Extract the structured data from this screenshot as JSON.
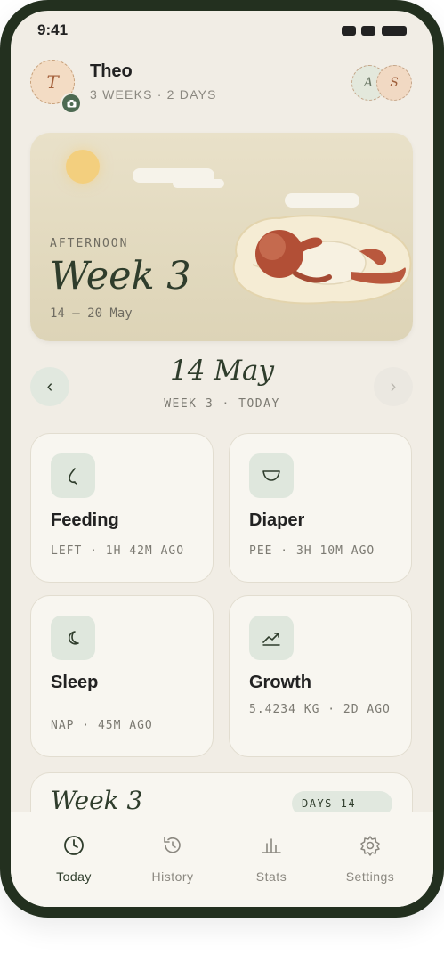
{
  "status": {
    "time": "9:41"
  },
  "profile": {
    "initial": "T",
    "name": "Theo",
    "age": "3 WEEKS · 2 DAYS",
    "caregivers": [
      "A",
      "S"
    ]
  },
  "hero": {
    "part_of_day": "AFTERNOON",
    "title": "Week 3",
    "range": "14 — 20 May"
  },
  "date_nav": {
    "date": "14 May",
    "subtitle": "WEEK 3 · TODAY"
  },
  "cards": [
    {
      "title": "Feeding",
      "subtitle": "LEFT · 1H 42M AGO",
      "icon": "feeding-icon"
    },
    {
      "title": "Diaper",
      "subtitle": "PEE · 3H 10M AGO",
      "icon": "diaper-icon"
    },
    {
      "title": "Sleep",
      "subtitle": "NAP · 45M AGO",
      "icon": "moon-icon"
    },
    {
      "title": "Growth",
      "subtitle": "5.4234 KG · 2D AGO",
      "icon": "trend-icon"
    }
  ],
  "week_summary": {
    "title": "Week 3",
    "badge": "DAYS 14–"
  },
  "tabs": [
    {
      "label": "Today",
      "icon": "clock-icon",
      "active": true
    },
    {
      "label": "History",
      "icon": "history-icon",
      "active": false
    },
    {
      "label": "Stats",
      "icon": "bar-chart-icon",
      "active": false
    },
    {
      "label": "Settings",
      "icon": "gear-icon",
      "active": false
    }
  ],
  "colors": {
    "accent": "#2f3d2c",
    "frame": "#23301f",
    "background": "#f1ede5"
  }
}
